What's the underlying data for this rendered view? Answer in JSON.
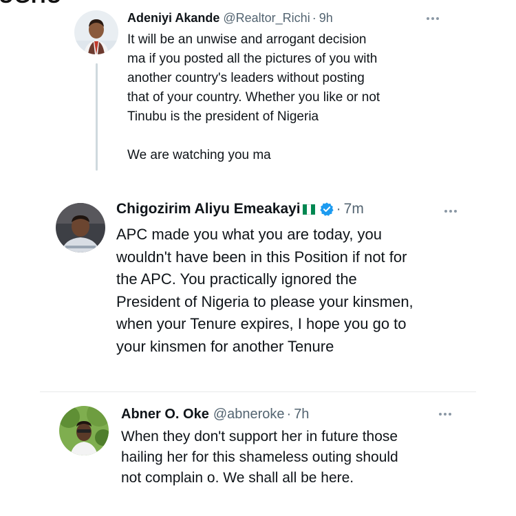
{
  "top_cut_text": "UGHU",
  "tweets": [
    {
      "name": "Adeniyi Akande",
      "handle": "@Realtor_Richi",
      "dot": "·",
      "time": "9h",
      "text": "It will be an unwise and arrogant decision\nma if you posted all the pictures of you with\nanother country's leaders without posting\nthat of your country. Whether you like or not\nTinubu is the president of Nigeria\n\nWe are watching you ma",
      "avatar_icon": "profile-photo"
    },
    {
      "name": "Chigozirim Aliyu Emeakayi",
      "handle": "",
      "dot": "·",
      "time": "7m",
      "flag_icon": "nigeria-flag",
      "verified_icon": "verified-badge",
      "text": "APC made you what you are today, you\nwouldn't have been in this Position if not for\nthe APC. You practically ignored the\nPresident of Nigeria to please your kinsmen,\nwhen your Tenure expires, I hope you go to\nyour kinsmen for another Tenure",
      "avatar_icon": "profile-photo"
    },
    {
      "name": "Abner O. Oke",
      "handle": "@abneroke",
      "dot": "·",
      "time": "7h",
      "text": "When they don't support her in future those\nhailing her for this shameless outing should\nnot complain o. We shall all be here.",
      "avatar_icon": "profile-photo"
    }
  ],
  "colors": {
    "text": "#0f1419",
    "secondary": "#536471",
    "verified": "#1d9bf0",
    "flag_green": "#008751",
    "divider": "#e7e9ea"
  },
  "more_icon": "more-horizontal-icon"
}
